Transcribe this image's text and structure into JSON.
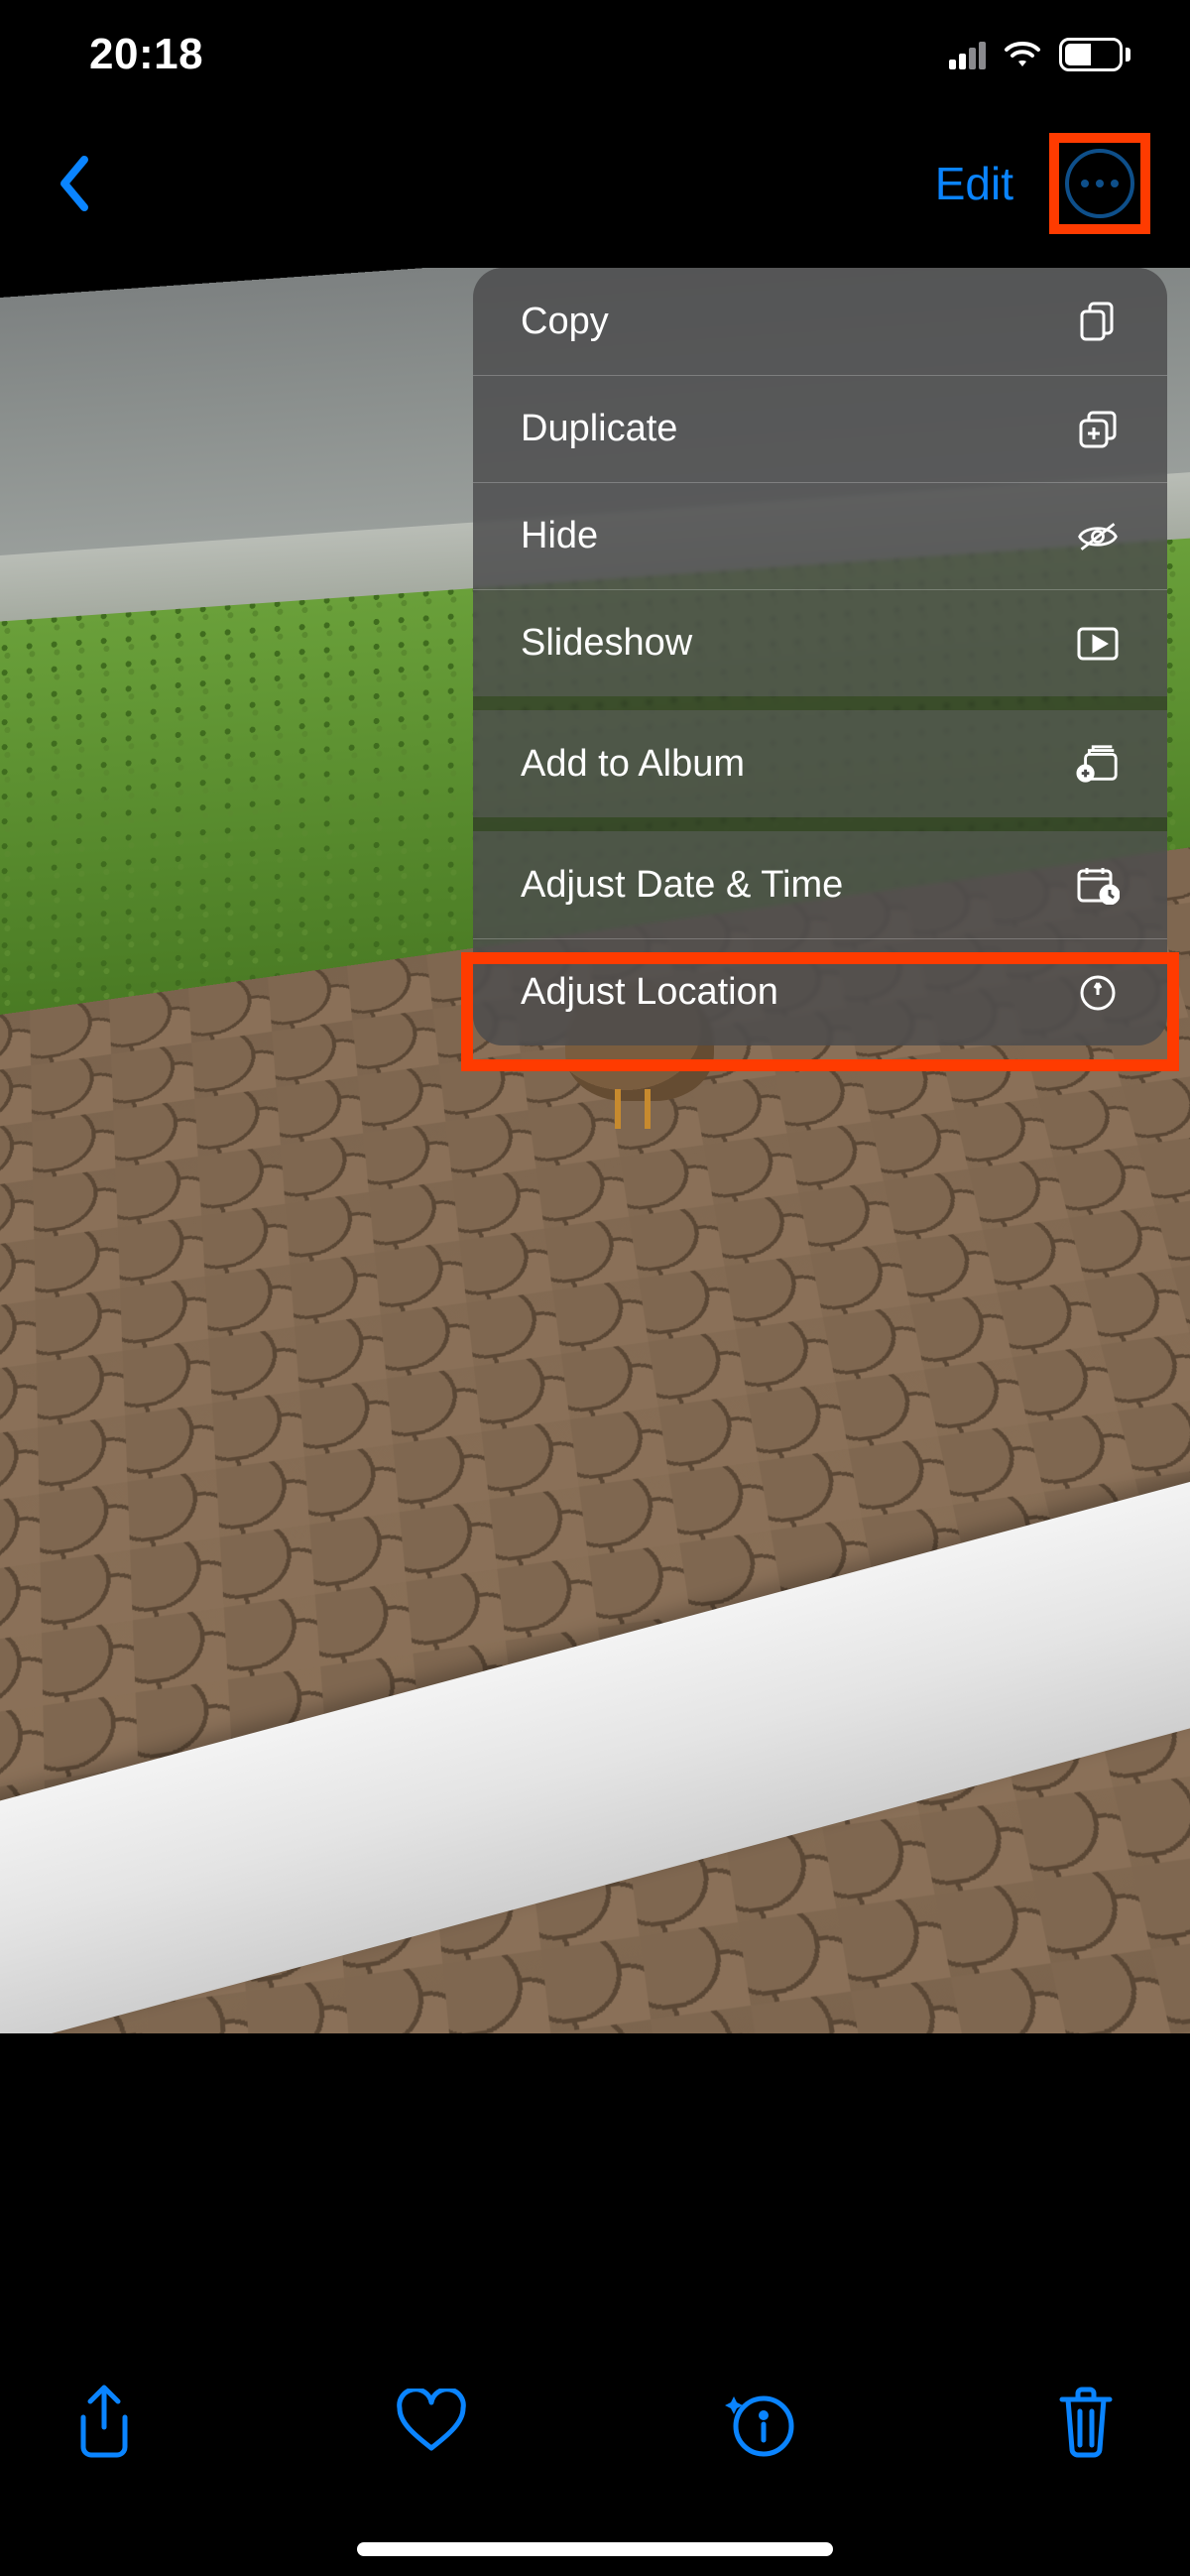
{
  "status": {
    "time": "20:18",
    "cell_bars_active": 2,
    "battery_pct": "45"
  },
  "nav": {
    "edit_label": "Edit"
  },
  "menu": {
    "items": [
      {
        "id": "copy",
        "label": "Copy",
        "icon": "copy-icon"
      },
      {
        "id": "duplicate",
        "label": "Duplicate",
        "icon": "duplicate-icon"
      },
      {
        "id": "hide",
        "label": "Hide",
        "icon": "eye-off-icon"
      },
      {
        "id": "slideshow",
        "label": "Slideshow",
        "icon": "play-rect-icon"
      },
      {
        "id": "add-to-album",
        "label": "Add to Album",
        "icon": "album-add-icon"
      },
      {
        "id": "adjust-datetime",
        "label": "Adjust Date & Time",
        "icon": "calendar-clock-icon"
      },
      {
        "id": "adjust-location",
        "label": "Adjust Location",
        "icon": "location-pin-icon"
      }
    ]
  },
  "highlights": {
    "more_button": true,
    "adjust_location": true
  },
  "colors": {
    "accent": "#0a84ff",
    "highlight_box": "#ff3b00"
  }
}
